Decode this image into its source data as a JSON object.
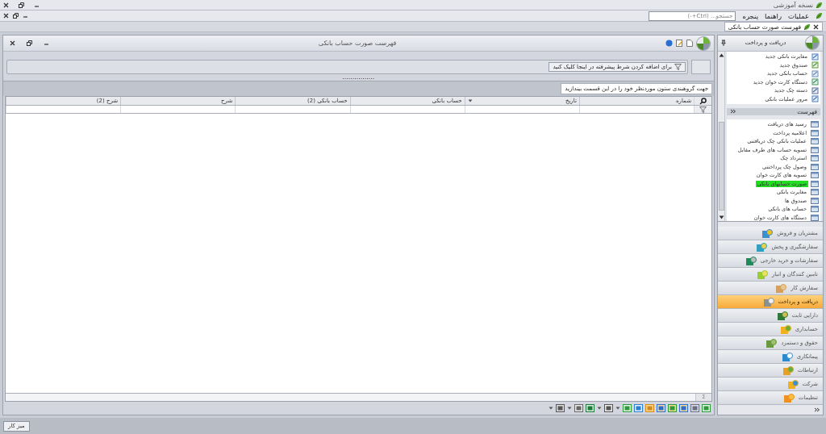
{
  "app": {
    "title": "نسخه آموزشی"
  },
  "menu": {
    "items": [
      "عملیات",
      "راهنما",
      "پنجره"
    ],
    "search": {
      "placeholder": "جستجو... (Ctrl+-)"
    }
  },
  "doc_tabs": [
    {
      "label": "فهرست صورت حساب بانکی",
      "selected": true
    }
  ],
  "list_window": {
    "title": "فهرست صورت حساب بانکی",
    "filter_hint": "برای اضافه کردن شرط پیشرفته در اینجا کلیک کنید",
    "group_hint": "جهت گروهبندی ستون موردنظر خود را در این قسمت بیندازید",
    "columns": [
      {
        "label": "شماره",
        "sorted": false
      },
      {
        "label": "تاریخ",
        "sorted": true
      },
      {
        "label": "حساب بانکی",
        "sorted": false
      },
      {
        "label": "حساب بانکی (2)",
        "sorted": false
      },
      {
        "label": "شرح",
        "sorted": false
      },
      {
        "label": "شرح (2)",
        "sorted": false
      }
    ],
    "footer_symbol": "Σ"
  },
  "side_panel": {
    "title": "دریافت و پرداخت",
    "tasks": [
      "مغایرت بانکی جدید",
      "صندوق جدید",
      "حساب بانکی جدید",
      "دستگاه کارت خوان جدید",
      "دسته چک جدید",
      "مرور عملیات بانکی"
    ],
    "list_title": "فهرست",
    "list": [
      {
        "label": "رسید های دریافت",
        "selected": false
      },
      {
        "label": "اعلامیه پرداخت",
        "selected": false
      },
      {
        "label": "عملیات بانکی چک دریافتنی",
        "selected": false
      },
      {
        "label": "تسویه حساب های طرف مقابل",
        "selected": false
      },
      {
        "label": "استرداد چک",
        "selected": false
      },
      {
        "label": "وصول چک پرداختنی",
        "selected": false
      },
      {
        "label": "تسویه های کارت خوان",
        "selected": false
      },
      {
        "label": "صورت حسابهای بانکی",
        "selected": true
      },
      {
        "label": "مغایرت بانکی",
        "selected": false
      },
      {
        "label": "صندوق ها",
        "selected": false
      },
      {
        "label": "حساب های بانکی",
        "selected": false
      },
      {
        "label": "دستگاه های کارت خوان",
        "selected": false
      }
    ],
    "modules": [
      {
        "label": "مشتریان و فروش",
        "selected": false
      },
      {
        "label": "سفارشگیری و پخش",
        "selected": false
      },
      {
        "label": "سفارشات و خرید خارجی",
        "selected": false
      },
      {
        "label": "تامین کنندگان و انبار",
        "selected": false
      },
      {
        "label": "سفارش کار",
        "selected": false
      },
      {
        "label": "دریافت و پرداخت",
        "selected": true
      },
      {
        "label": "دارایی ثابت",
        "selected": false
      },
      {
        "label": "حسابداری",
        "selected": false
      },
      {
        "label": "حقوق و دستمزد",
        "selected": false
      },
      {
        "label": "پیمانکاری",
        "selected": false
      },
      {
        "label": "ارتباطات",
        "selected": false
      },
      {
        "label": "شرکت",
        "selected": false
      },
      {
        "label": "تنظیمات",
        "selected": false
      }
    ]
  },
  "status_bar": {
    "desk_button": "میز کار"
  }
}
